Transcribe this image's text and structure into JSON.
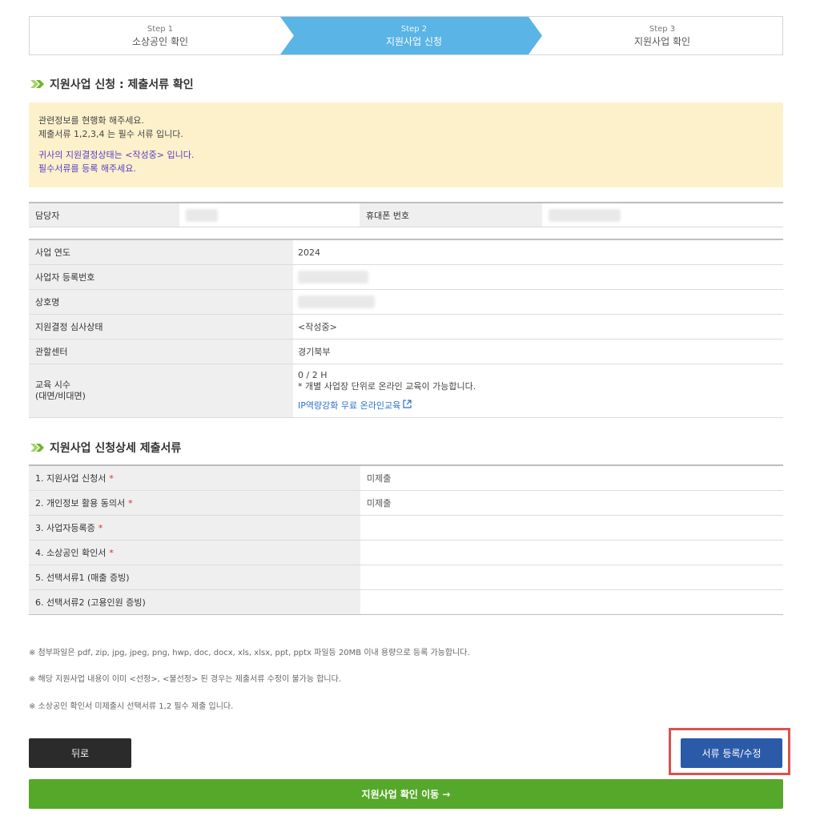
{
  "stepper": {
    "steps": [
      {
        "num": "Step 1",
        "label": "소상공인 확인"
      },
      {
        "num": "Step 2",
        "label": "지원사업 신청"
      },
      {
        "num": "Step 3",
        "label": "지원사업 확인"
      }
    ],
    "active_color": "#5ab4e5"
  },
  "section1": {
    "title": "지원사업 신청 : 제출서류 확인"
  },
  "notice": {
    "line1": "관련정보를 현행화 해주세요.",
    "line2": "제출서류 1,2,3,4 는 필수 서류 입니다.",
    "line3": "귀사의 지원결정상태는 <작성중> 입니다.",
    "line4": "필수서류를 등록 해주세요."
  },
  "contact": {
    "manager_label": "담당자",
    "phone_label": "휴대폰 번호"
  },
  "info": {
    "year_label": "사업 연도",
    "year_value": "2024",
    "biz_no_label": "사업자 등록번호",
    "company_label": "상호명",
    "status_label": "지원결정 심사상태",
    "status_value": "<작성중>",
    "center_label": "관할센터",
    "center_value": "경기북부",
    "edu_label_1": "교육 시수",
    "edu_label_2": "(대면/비대면)",
    "edu_hours": "0 / 2 H",
    "edu_note": " * 개별 사업장 단위로 온라인 교육이 가능합니다.",
    "edu_link": "IP역량강화 무료 온라인교육"
  },
  "section2": {
    "title": "지원사업 신청상세 제출서류"
  },
  "docs": [
    {
      "label": "1. 지원사업 신청서",
      "required": "*",
      "status": "미제출"
    },
    {
      "label": "2. 개인정보 활용 동의서",
      "required": "*",
      "status": "미제출"
    },
    {
      "label": "3. 사업자등록증",
      "required": "*",
      "status": ""
    },
    {
      "label": "4. 소상공인 확인서",
      "required": "*",
      "status": ""
    },
    {
      "label": "5. 선택서류1 (매출 증빙)",
      "required": "",
      "status": ""
    },
    {
      "label": "6. 선택서류2 (고용인원 증빙)",
      "required": "",
      "status": ""
    }
  ],
  "notes": [
    "※ 첨부파일은 pdf, zip, jpg, jpeg, png, hwp, doc, docx, xls, xlsx, ppt, pptx 파일등 20MB 이내 용량으로 등록 가능합니다.",
    "※ 해당 지원사업 내용이 이미 <선정>, <불선정> 된 경우는 제출서류 수정이 불가능 합니다.",
    "※ 소상공인 확인서 미제출시 선택서류 1,2 필수 제출 입니다."
  ],
  "buttons": {
    "back": "뒤로",
    "register": "서류 등록/수정",
    "go": "지원사업 확인 이동 →"
  }
}
